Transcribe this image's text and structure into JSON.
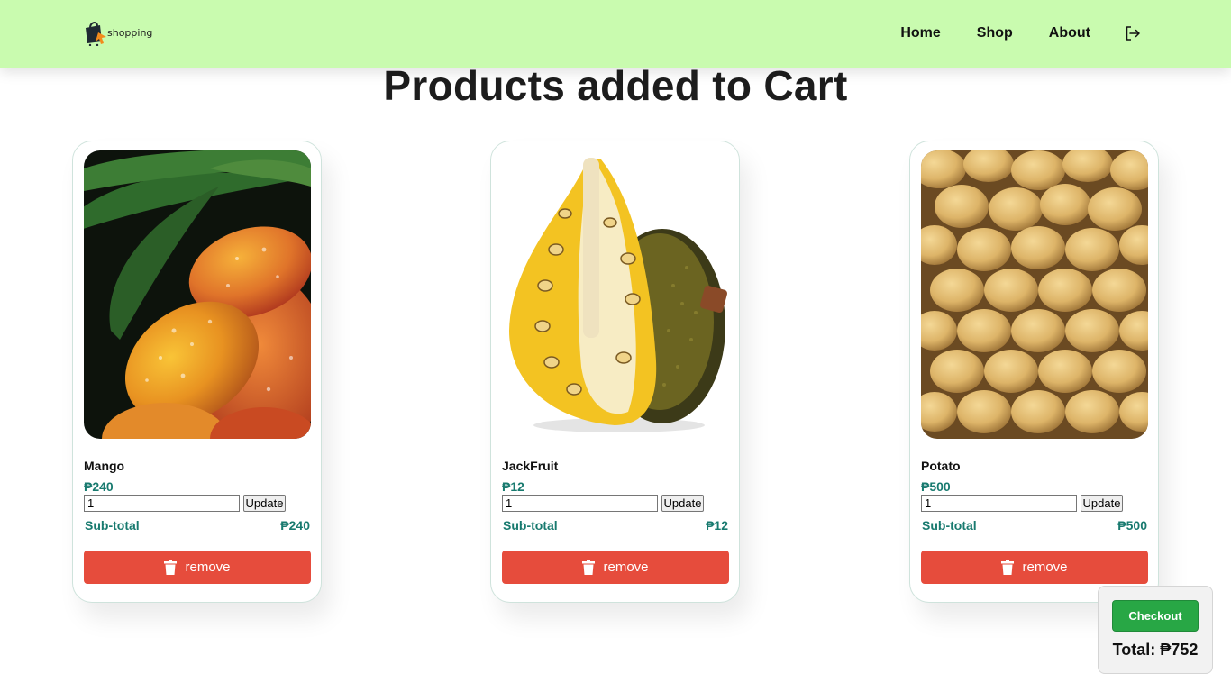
{
  "header": {
    "logo_text": "shopping",
    "nav": [
      "Home",
      "Shop",
      "About"
    ],
    "logout_icon": "logout-icon",
    "background_color": "#c9fbaf"
  },
  "page_title": "Products added to Cart",
  "cart_items": [
    {
      "name": "Mango",
      "price": "₱240",
      "quantity": "1",
      "update_label": "Update",
      "subtotal_label": "Sub-total",
      "subtotal": "₱240",
      "remove_label": "remove",
      "image": "mango-image"
    },
    {
      "name": "JackFruit",
      "price": "₱12",
      "quantity": "1",
      "update_label": "Update",
      "subtotal_label": "Sub-total",
      "subtotal": "₱12",
      "remove_label": "remove",
      "image": "jackfruit-image"
    },
    {
      "name": "Potato",
      "price": "₱500",
      "quantity": "1",
      "update_label": "Update",
      "subtotal_label": "Sub-total",
      "subtotal": "₱500",
      "remove_label": "remove",
      "image": "potato-image"
    }
  ],
  "checkout": {
    "button_label": "Checkout",
    "total_text": "Total: ₱752"
  },
  "colors": {
    "accent_teal": "#187a6f",
    "remove_red": "#e64c3c",
    "checkout_green": "#28a745"
  }
}
